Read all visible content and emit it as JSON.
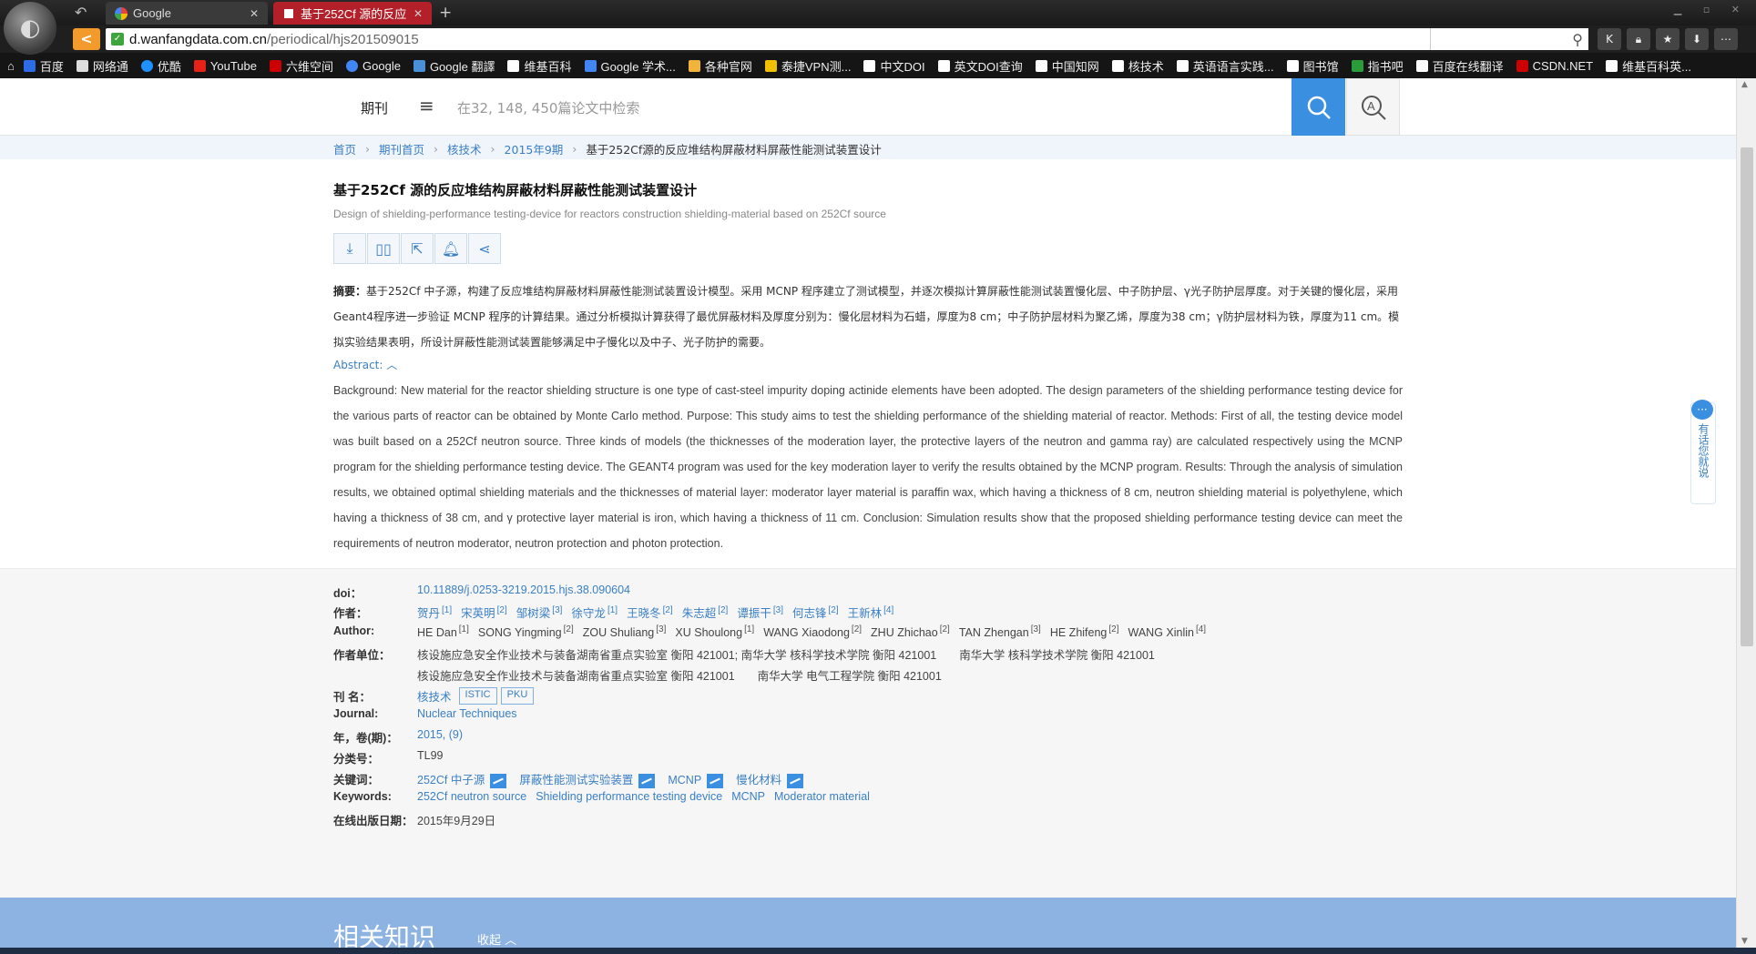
{
  "browser": {
    "tabs": [
      {
        "label": "Google",
        "active": false
      },
      {
        "label": "基于252Cf 源的反应",
        "active": true
      }
    ],
    "url_host": "d.wanfangdata.com.cn",
    "url_path": "/periodical/hjs201509015",
    "bookmarks": [
      "百度",
      "网络通",
      "优酷",
      "YouTube",
      "六维空间",
      "Google",
      "Google 翻譯",
      "维基百科",
      "Google 学术...",
      "各种官网",
      "泰捷VPN测...",
      "中文DOI",
      "英文DOI查询",
      "中国知网",
      "核技术",
      "英语语言实践...",
      "图书馆",
      "指书吧",
      "百度在线翻译",
      "CSDN.NET",
      "维基百科英..."
    ]
  },
  "site": {
    "nav_label": "期刊",
    "search_placeholder": "在32, 148, 450篇论文中检索"
  },
  "breadcrumb": [
    "首页",
    "期刊首页",
    "核技术",
    "2015年9期",
    "基于252Cf源的反应堆结构屏蔽材料屏蔽性能测试装置设计"
  ],
  "article": {
    "title_cn": "基于252Cf 源的反应堆结构屏蔽材料屏蔽性能测试装置设计",
    "title_en": "Design of shielding-performance testing-device for reactors construction shielding-material based on 252Cf source",
    "abstract_label": "摘要：",
    "abstract_cn": "基于252Cf 中子源，构建了反应堆结构屏蔽材料屏蔽性能测试装置设计模型。采用 MCNP 程序建立了测试模型，并逐次模拟计算屏蔽性能测试装置慢化层、中子防护层、γ光子防护层厚度。对于关键的慢化层，采用Geant4程序进一步验证 MCNP 程序的计算结果。通过分析模拟计算获得了最优屏蔽材料及厚度分别为：慢化层材料为石蜡，厚度为8 cm；中子防护层材料为聚乙烯，厚度为38 cm；γ防护层材料为铁，厚度为11 cm。模拟实验结果表明，所设计屏蔽性能测试装置能够满足中子慢化以及中子、光子防护的需要。",
    "abstract_toggle": "Abstract:",
    "abstract_en": "Background: New material for the reactor shielding structure is one type of cast-steel impurity doping actinide elements have been adopted. The design parameters of the shielding performance testing device for the various parts of reactor can be obtained by Monte Carlo method. Purpose: This study aims to test the shielding performance of the shielding material of reactor. Methods: First of all, the testing device model was built based on a 252Cf neutron source. Three kinds of models (the thicknesses of the moderation layer, the protective layers of the neutron and gamma ray) are calculated respectively using the MCNP program for the shielding performance testing device. The GEANT4 program was used for the key moderation layer to verify the results obtained by the MCNP program. Results: Through the analysis of simulation results, we obtained optimal shielding materials and the thicknesses of material layer: moderator layer material is paraffin wax, which having a thickness of 8 cm, neutron shielding material is polyethylene, which having a thickness of 38 cm, and γ protective layer material is iron, which having a thickness of 11 cm. Conclusion: Simulation results show that the proposed shielding performance testing device can meet the requirements of neutron moderator, neutron protection and photon protection."
  },
  "meta": {
    "doi_label": "doi：",
    "doi": "10.11889/j.0253-3219.2015.hjs.38.090604",
    "authors_label": "作者：",
    "authors_cn": [
      {
        "name": "贺丹",
        "ref": "[1]"
      },
      {
        "name": "宋英明",
        "ref": "[2]"
      },
      {
        "name": "邹树梁",
        "ref": "[3]"
      },
      {
        "name": "徐守龙",
        "ref": "[1]"
      },
      {
        "name": "王晓冬",
        "ref": "[2]"
      },
      {
        "name": "朱志超",
        "ref": "[2]"
      },
      {
        "name": "谭振干",
        "ref": "[3]"
      },
      {
        "name": "何志锋",
        "ref": "[2]"
      },
      {
        "name": "王新林",
        "ref": "[4]"
      }
    ],
    "authors_en_label": "Author:",
    "authors_en": [
      {
        "name": "HE Dan",
        "ref": "[1]"
      },
      {
        "name": "SONG Yingming",
        "ref": "[2]"
      },
      {
        "name": "ZOU Shuliang",
        "ref": "[3]"
      },
      {
        "name": "XU Shoulong",
        "ref": "[1]"
      },
      {
        "name": "WANG Xiaodong",
        "ref": "[2]"
      },
      {
        "name": "ZHU Zhichao",
        "ref": "[2]"
      },
      {
        "name": "TAN Zhengan",
        "ref": "[3]"
      },
      {
        "name": "HE Zhifeng",
        "ref": "[2]"
      },
      {
        "name": "WANG Xinlin",
        "ref": "[4]"
      }
    ],
    "affil_label": "作者单位：",
    "affil_line1": "核设施应急安全作业技术与装备湖南省重点实验室 衡阳 421001; 南华大学 核科学技术学院 衡阳 421001　　南华大学 核科学技术学院 衡阳 421001",
    "affil_line2": "核设施应急安全作业技术与装备湖南省重点实验室 衡阳 421001　　南华大学 电气工程学院 衡阳 421001",
    "journal_label": "刊 名：",
    "journal_cn": "核技术",
    "journal_badges": [
      "ISTIC",
      "PKU"
    ],
    "journal_en_label": "Journal:",
    "journal_en": "Nuclear Techniques",
    "issue_label": "年，卷(期)：",
    "issue": "2015, (9)",
    "class_label": "分类号：",
    "class": "TL99",
    "kw_label": "关键词：",
    "keywords_cn": [
      "252Cf 中子源",
      "屏蔽性能测试实验装置",
      "MCNP",
      "慢化材料"
    ],
    "kw_en_label": "Keywords:",
    "keywords_en": [
      "252Cf neutron source",
      "Shielding performance testing device",
      "MCNP",
      "Moderator material"
    ],
    "date_label": "在线出版日期：",
    "date": "2015年9月29日"
  },
  "related": {
    "title": "相关知识",
    "collapse": "收起"
  },
  "feedback": "有话您就说"
}
